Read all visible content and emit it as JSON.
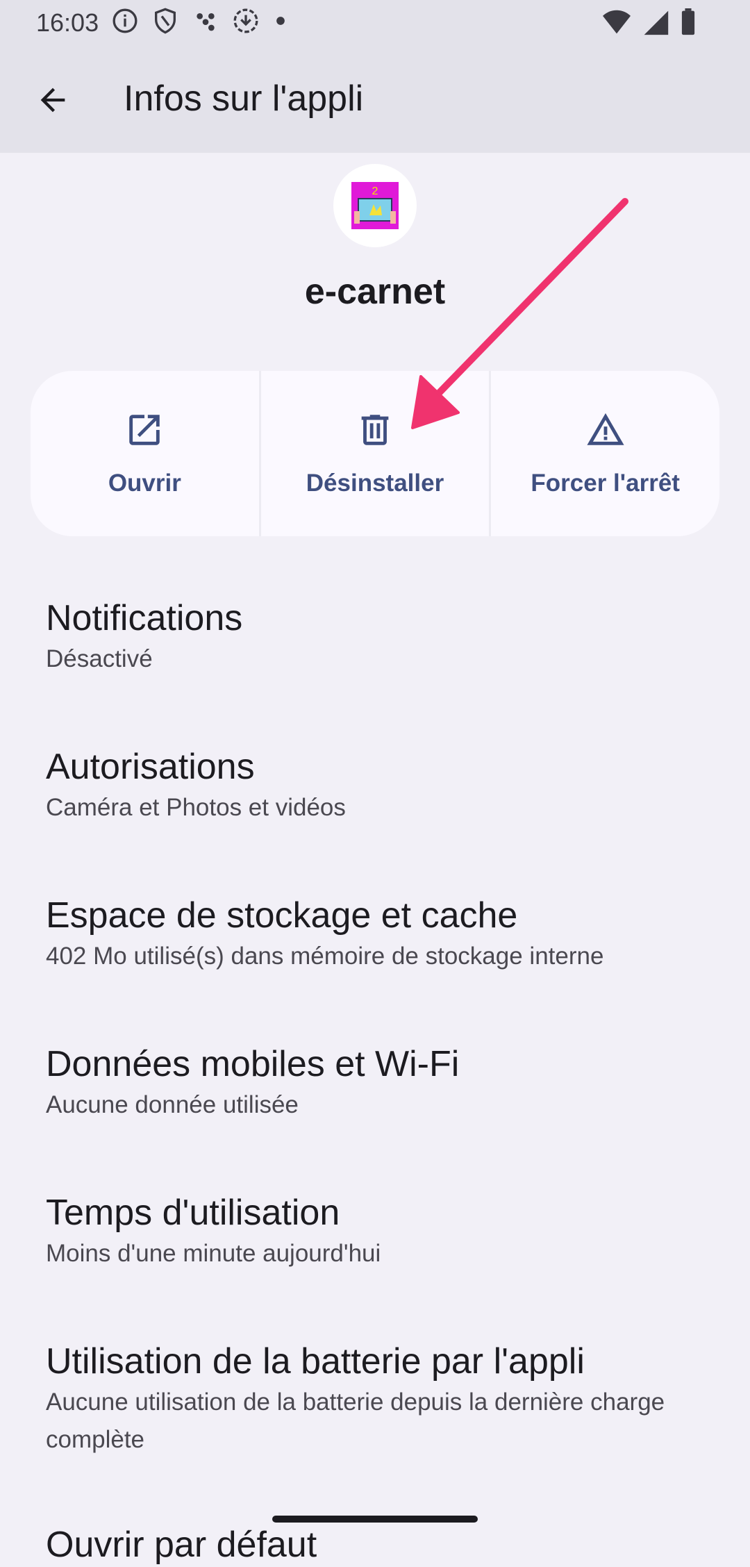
{
  "status_bar": {
    "time": "16:03",
    "left_icons": [
      "info-icon",
      "shield-icon",
      "dots-icon",
      "download-icon",
      "dot-icon"
    ],
    "right_icons": [
      "wifi-icon",
      "signal-icon",
      "battery-icon"
    ]
  },
  "app_bar": {
    "title": "Infos sur l'appli"
  },
  "app": {
    "name": "e-carnet",
    "icon": "e-carnet-app-icon"
  },
  "actions": [
    {
      "label": "Ouvrir",
      "icon": "open-external-icon"
    },
    {
      "label": "Désinstaller",
      "icon": "trash-icon"
    },
    {
      "label": "Forcer l'arrêt",
      "icon": "warning-icon"
    }
  ],
  "settings": [
    {
      "title": "Notifications",
      "summary": "Désactivé"
    },
    {
      "title": "Autorisations",
      "summary": "Caméra et Photos et vidéos"
    },
    {
      "title": "Espace de stockage et cache",
      "summary": "402 Mo utilisé(s) dans mémoire de stockage interne"
    },
    {
      "title": "Données mobiles et Wi-Fi",
      "summary": "Aucune donnée utilisée"
    },
    {
      "title": "Temps d'utilisation",
      "summary": "Moins d'une minute aujourd'hui"
    },
    {
      "title": "Utilisation de la batterie par l'appli",
      "summary": "Aucune utilisation de la batterie depuis la dernière charge complète"
    },
    {
      "title": "Ouvrir par défaut",
      "summary": ""
    }
  ],
  "colors": {
    "background": "#f2f0f7",
    "app_bar": "#e3e2ea",
    "accent": "#3f4f80",
    "annotation_arrow": "#f0336e"
  }
}
